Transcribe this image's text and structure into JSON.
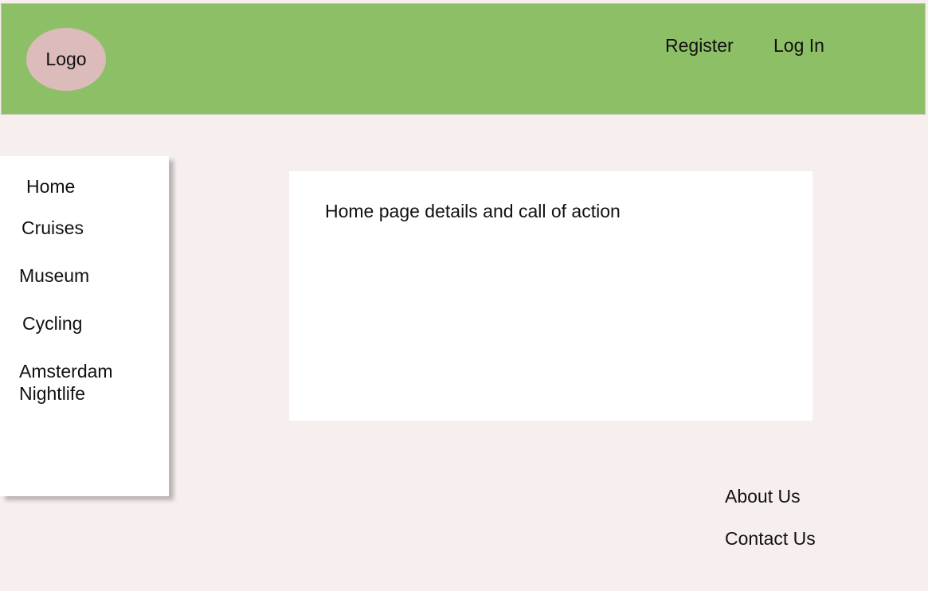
{
  "header": {
    "logo_label": "Logo",
    "nav": {
      "register": "Register",
      "login": "Log In"
    }
  },
  "sidebar": {
    "items": [
      {
        "label": "Home"
      },
      {
        "label": "Cruises"
      },
      {
        "label": "Museum"
      },
      {
        "label": "Cycling"
      },
      {
        "label": "Amsterdam Nightlife"
      }
    ]
  },
  "main": {
    "text": "Home page details and call of action"
  },
  "footer": {
    "about": "About Us",
    "contact": "Contact Us"
  },
  "colors": {
    "header_bg": "#8dbf67",
    "page_bg": "#f7efee",
    "logo_bg": "#dcbbbb",
    "panel_bg": "#ffffff"
  }
}
